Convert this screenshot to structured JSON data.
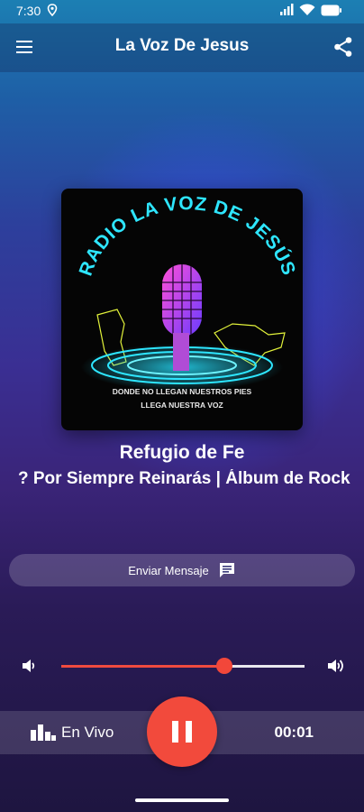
{
  "status_bar": {
    "time": "7:30"
  },
  "app_bar": {
    "title": "La Voz De Jesus"
  },
  "art": {
    "arc_text": "RADIO LA VOZ DE JESÚS",
    "tagline_1": "DONDE NO LLEGAN NUESTROS PIES",
    "tagline_2": "LLEGA NUESTRA VOZ"
  },
  "now_playing": {
    "title": "Refugio de Fe",
    "subtitle": "? Por Siempre Reinarás | Álbum de Rock"
  },
  "send_message": {
    "label": "Enviar Mensaje"
  },
  "volume": {
    "level_fraction": 0.67
  },
  "player": {
    "live_label": "En Vivo",
    "elapsed": "00:01"
  },
  "colors": {
    "accent": "#f24a3c"
  }
}
